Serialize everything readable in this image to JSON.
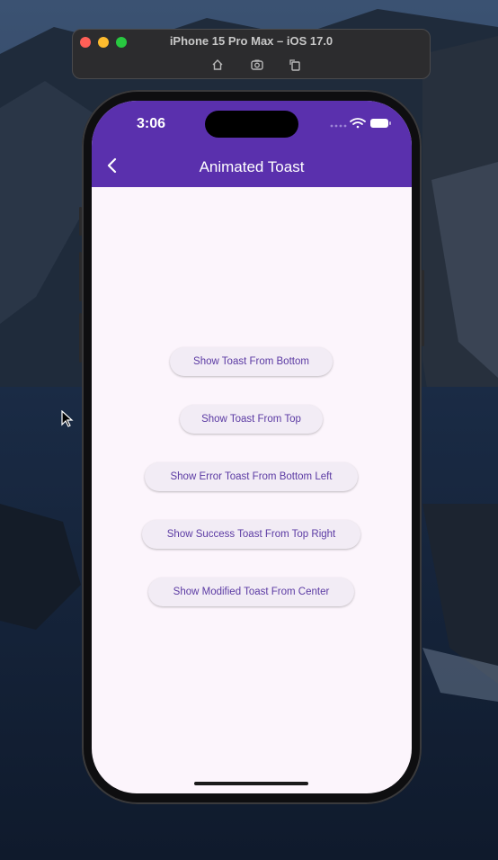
{
  "simulator": {
    "title": "iPhone 15 Pro Max – iOS 17.0",
    "tools": [
      "home-icon",
      "screenshot-icon",
      "rotate-icon"
    ]
  },
  "status_bar": {
    "time": "3:06",
    "icons": [
      "signal-dots-icon",
      "wifi-icon",
      "battery-icon"
    ]
  },
  "appbar": {
    "title": "Animated Toast",
    "back_icon": "chevron-left-icon",
    "color": "#5a30ad"
  },
  "buttons": [
    {
      "label": "Show Toast From Bottom"
    },
    {
      "label": "Show Toast From Top"
    },
    {
      "label": "Show Error Toast From Bottom Left"
    },
    {
      "label": "Show Success Toast From Top Right"
    },
    {
      "label": "Show Modified Toast From Center"
    }
  ],
  "colors": {
    "screen_bg": "#fcf5fc",
    "button_bg": "#f2ecf5",
    "button_text": "#5b3aa3"
  }
}
